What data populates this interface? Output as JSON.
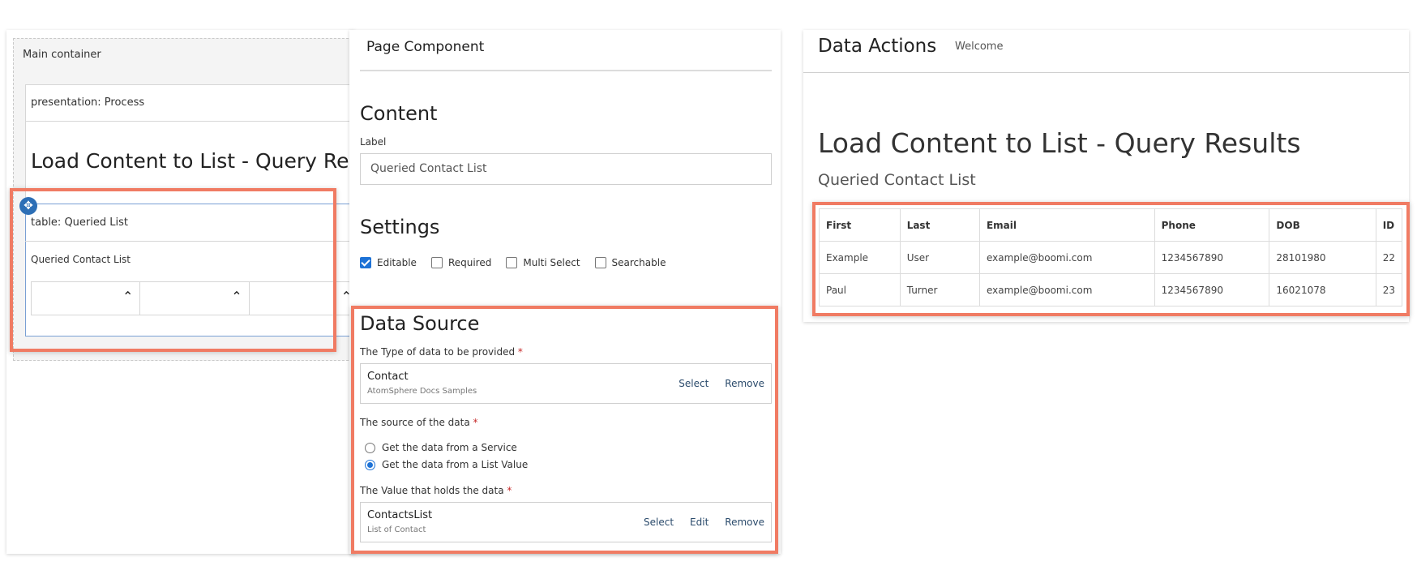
{
  "left_canvas": {
    "main_container_label": "Main container",
    "presentation_label": "presentation: Process",
    "title": "Load Content to List - Query Results",
    "table_component_label": "table: Queried List",
    "table_component_caption": "Queried Contact List",
    "move_icon": "move-icon",
    "column_icons": [
      "chevron-up-icon",
      "chevron-up-icon",
      "chevron-up-icon"
    ]
  },
  "properties": {
    "header": "Page Component",
    "content": {
      "title": "Content",
      "label_caption": "Label",
      "label_value": "Queried Contact List"
    },
    "settings": {
      "title": "Settings",
      "checkboxes": [
        {
          "label": "Editable",
          "checked": true
        },
        {
          "label": "Required",
          "checked": false
        },
        {
          "label": "Multi Select",
          "checked": false
        },
        {
          "label": "Searchable",
          "checked": false
        }
      ]
    },
    "data_source": {
      "title": "Data Source",
      "type_label": "The Type of data to be provided",
      "type_name": "Contact",
      "type_sub": "AtomSphere Docs Samples",
      "type_select": "Select",
      "type_remove": "Remove",
      "source_label": "The source of the data",
      "option_service": "Get the data from a Service",
      "option_list": "Get the data from a List Value",
      "selected_option": "Get the data from a List Value",
      "value_label": "The Value that holds the data",
      "value_name": "ContactsList",
      "value_sub": "List of Contact",
      "value_select": "Select",
      "value_edit": "Edit",
      "value_remove": "Remove",
      "required_mark": "*"
    }
  },
  "preview": {
    "app_title": "Data Actions",
    "welcome": "Welcome",
    "heading": "Load Content to List - Query Results",
    "subheading": "Queried Contact List",
    "columns": [
      "First",
      "Last",
      "Email",
      "Phone",
      "DOB",
      "ID"
    ],
    "rows": [
      [
        "Example",
        "User",
        "example@boomi.com",
        "1234567890",
        "28101980",
        "22"
      ],
      [
        "Paul",
        "Turner",
        "example@boomi.com",
        "1234567890",
        "16021078",
        "23"
      ]
    ]
  },
  "colors": {
    "highlight": "#f07b63",
    "accent": "#1d72d6"
  }
}
